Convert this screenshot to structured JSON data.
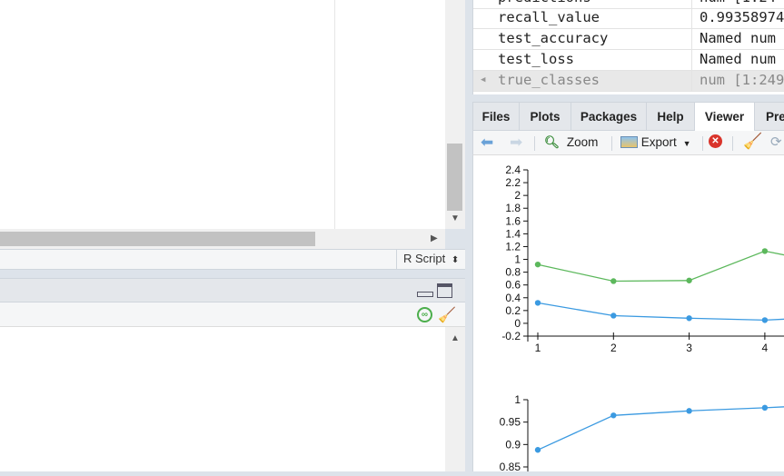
{
  "editor": {
    "mode_label": "R Script"
  },
  "environment": {
    "rows": [
      {
        "name": "predictions",
        "value": "num [1:24"
      },
      {
        "name": "recall_value",
        "value": "0.99358974"
      },
      {
        "name": "test_accuracy",
        "value": "Named num"
      },
      {
        "name": "test_loss",
        "value": "Named num"
      },
      {
        "name": "true_classes",
        "value": "num [1:249"
      }
    ]
  },
  "tabs": [
    "Files",
    "Plots",
    "Packages",
    "Help",
    "Viewer",
    "Pre"
  ],
  "active_tab": "Viewer",
  "toolbar": {
    "zoom_label": "Zoom",
    "export_label": "Export"
  },
  "colors": {
    "green_series": "#5cb85c",
    "blue_series": "#3b9ae1"
  },
  "chart_data": [
    {
      "type": "line",
      "x": [
        1,
        2,
        3,
        4
      ],
      "xticks": [
        "1",
        "2",
        "3",
        "4"
      ],
      "yticks": [
        "2.4",
        "2.2",
        "2",
        "1.8",
        "1.6",
        "1.4",
        "1.2",
        "1",
        "0.8",
        "0.6",
        "0.4",
        "0.2",
        "0",
        "-0.2"
      ],
      "ylim": [
        -0.2,
        2.4
      ],
      "series": [
        {
          "values": [
            0.92,
            0.66,
            0.67,
            1.13
          ],
          "color": "#5cb85c"
        },
        {
          "values": [
            0.32,
            0.12,
            0.08,
            0.05
          ],
          "color": "#3b9ae1"
        }
      ]
    },
    {
      "type": "line",
      "x": [
        1,
        2,
        3,
        4
      ],
      "yticks": [
        "1",
        "0.95",
        "0.9",
        "0.85"
      ],
      "ylim": [
        0.85,
        1.0
      ],
      "series": [
        {
          "values": [
            0.888,
            0.965,
            0.975,
            0.982
          ],
          "color": "#3b9ae1"
        }
      ]
    }
  ]
}
